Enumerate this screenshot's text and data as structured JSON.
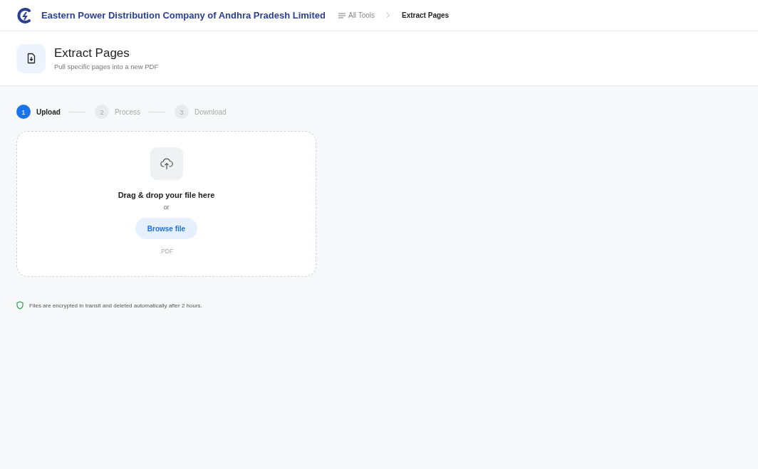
{
  "header": {
    "company": "Eastern Power Distribution Company of Andhra Pradesh Limited",
    "breadcrumb": [
      {
        "label": "All Tools",
        "kind": "link"
      },
      {
        "label": "Extract Pages",
        "kind": "current"
      }
    ]
  },
  "tool": {
    "title": "Extract Pages",
    "subtitle": "Pull specific pages into a new PDF"
  },
  "steps": [
    {
      "number": "1",
      "label": "Upload",
      "selected": true
    },
    {
      "number": "2",
      "label": "Process",
      "selected": false
    },
    {
      "number": "3",
      "label": "Download",
      "selected": false
    }
  ],
  "dropzone": {
    "heading": "Drag & drop your file here",
    "separator": "or",
    "button": "Browse file",
    "formats": ".PDF"
  },
  "security_note": "Files are encrypted in transit and deleted automatically after 2 hours."
}
